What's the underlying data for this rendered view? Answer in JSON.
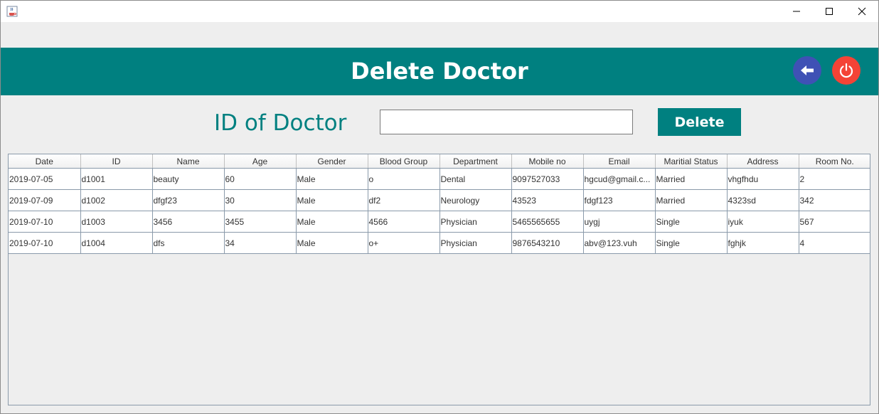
{
  "titlebar": {
    "app_icon": "java-coffee-icon",
    "minimize_icon": "minimize-icon",
    "maximize_icon": "maximize-icon",
    "close_icon": "close-icon"
  },
  "header": {
    "title": "Delete Doctor",
    "back_icon": "arrow-left-icon",
    "power_icon": "power-icon",
    "background": "#008080"
  },
  "form": {
    "id_label": "ID of Doctor",
    "id_value": "",
    "delete_label": "Delete"
  },
  "table": {
    "columns": [
      "Date",
      "ID",
      "Name",
      "Age",
      "Gender",
      "Blood Group",
      "Department",
      "Mobile no",
      "Email",
      "Maritial Status",
      "Address",
      "Room No."
    ],
    "rows": [
      [
        "2019-07-05",
        "d1001",
        "beauty",
        "60",
        "Male",
        "o",
        "Dental",
        "9097527033",
        "hgcud@gmail.c...",
        "Married",
        "vhgfhdu",
        "2"
      ],
      [
        "2019-07-09",
        "d1002",
        "dfgf23",
        "30",
        "Male",
        "df2",
        "Neurology",
        "43523",
        "fdgf123",
        "Married",
        "4323sd",
        "342"
      ],
      [
        "2019-07-10",
        "d1003",
        "3456",
        "3455",
        "Male",
        "4566",
        "Physician",
        "5465565655",
        "uygj",
        "Single",
        "iyuk",
        "567"
      ],
      [
        "2019-07-10",
        "d1004",
        "dfs",
        "34",
        "Male",
        "o+",
        "Physician",
        "9876543210",
        "abv@123.vuh",
        "Single",
        "fghjk",
        "4"
      ]
    ]
  },
  "colors": {
    "accent": "#008080",
    "back_button": "#3f51b5",
    "power_button": "#f44336"
  }
}
